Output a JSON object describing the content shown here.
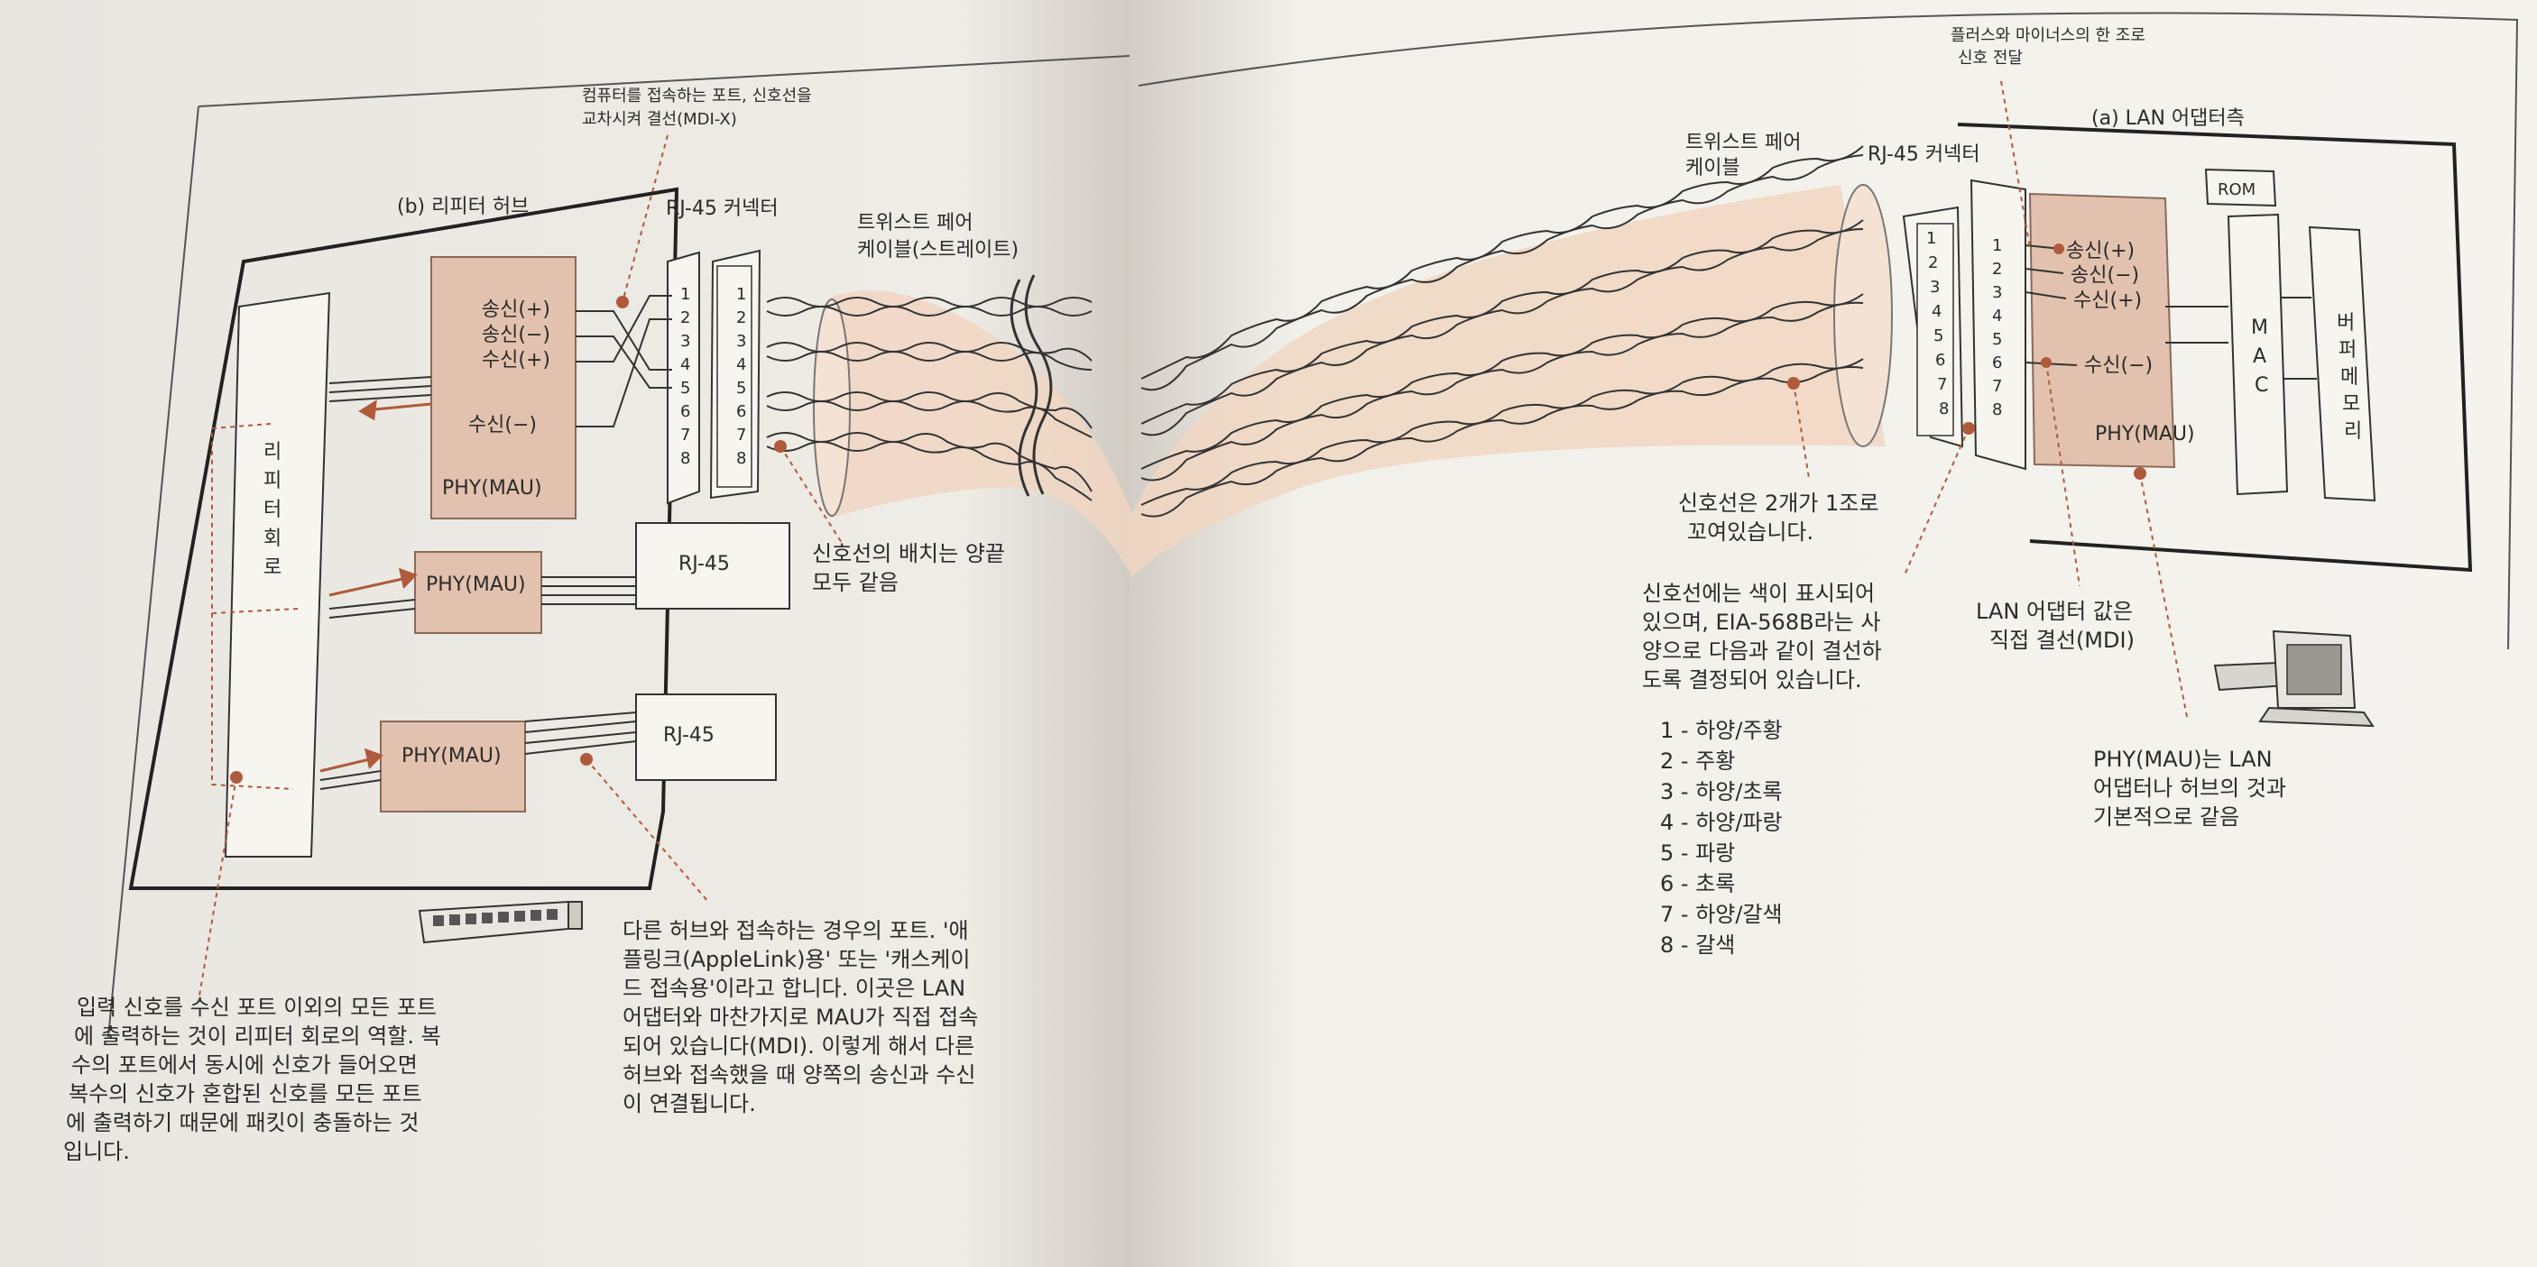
{
  "repeater_hub": {
    "title": "(b) 리피터 허브",
    "repeater_circuit_label": [
      "리",
      "피",
      "터",
      "회",
      "로"
    ],
    "phy_signals": [
      "송신(+)",
      "송신(−)",
      "수신(+)",
      "수신(−)"
    ],
    "phy_main_label": "PHY(MAU)",
    "phy_port2_label": "PHY(MAU)",
    "phy_port3_label": "PHY(MAU)",
    "rj45_connector_label": "RJ-45 커넥터",
    "rj45_port2_label": "RJ-45",
    "rj45_port3_label": "RJ-45",
    "pins_left": [
      "1",
      "2",
      "3",
      "4",
      "5",
      "6",
      "7",
      "8"
    ],
    "pins_right": [
      "1",
      "2",
      "3",
      "4",
      "5",
      "6",
      "7",
      "8"
    ]
  },
  "cable": {
    "left_label_line1": "트위스트 페어",
    "left_label_line2": "케이블(스트레이트)",
    "right_label_line1": "트위스트 페어",
    "right_label_line2": "케이블",
    "right_connector_label": "RJ-45 커넥터"
  },
  "lan_adapter": {
    "title": "(a) LAN 어댑터측",
    "rom_label": "ROM",
    "mac_label": [
      "M",
      "A",
      "C"
    ],
    "buffer_label": [
      "버",
      "퍼",
      "메",
      "모",
      "리"
    ],
    "phy_signals": [
      "송신(+)",
      "송신(−)",
      "수신(+)",
      "수신(−)"
    ],
    "phy_label": "PHY(MAU)",
    "pins_left": [
      "1",
      "2",
      "3",
      "4",
      "5",
      "6",
      "7",
      "8"
    ],
    "pins_right": [
      "1",
      "2",
      "3",
      "4",
      "5",
      "6",
      "7",
      "8"
    ]
  },
  "annotations": {
    "mdix_line1": "컴퓨터를 접속하는 포트, 신호선을",
    "mdix_line2": "교차시켜 결선(MDI-X)",
    "same_line1": "신호선의 배치는 양끝",
    "same_line2": "모두 같음",
    "pair_line1": "플러스와 마이너스의 한 조로",
    "pair_line2": "신호 전달",
    "twisted_line1": "신호선은 2개가 1조로",
    "twisted_line2": "꼬여있습니다.",
    "colors_lines": [
      "신호선에는 색이 표시되어",
      "있으며, EIA-568B라는 사",
      "양으로 다음과 같이 결선하",
      "도록 결정되어 있습니다."
    ],
    "mdi_line1": "LAN 어댑터 값은",
    "mdi_line2": "직접 결선(MDI)",
    "phy_same_lines": [
      "PHY(MAU)는 LAN",
      "어댑터나 허브의 것과",
      "기본적으로 같음"
    ],
    "repeater_role_lines": [
      "입력 신호를 수신 포트 이외의 모든 포트",
      "에 출력하는 것이 리피터 회로의 역할. 복",
      "수의 포트에서 동시에 신호가 들어오면",
      "복수의 신호가 혼합된 신호를 모든 포트",
      "에 출력하기 때문에 패킷이 충돌하는 것",
      "입니다."
    ],
    "cascade_lines": [
      "다른 허브와 접속하는 경우의 포트. '애",
      "플링크(AppleLink)용' 또는 '캐스케이",
      "드 접속용'이라고 합니다. 이곳은 LAN",
      "어댑터와 마찬가지로 MAU가 직접 접속",
      "되어 있습니다(MDI). 이렇게 해서 다른",
      "허브와 접속했을 때 양쪽의 송신과 수신",
      "이 연결됩니다."
    ]
  },
  "wire_colors": [
    "1 - 하양/주황",
    "2 - 주황",
    "3 - 하양/초록",
    "4 - 하양/파랑",
    "5 - 파랑",
    "6 - 초록",
    "7 - 하양/갈색",
    "8 - 갈색"
  ],
  "colors": {
    "accent": "#b05a3c",
    "phy_fill": "#e2c2ae",
    "cable_fill": "#f0d6c2",
    "paper": "#f4f2ec",
    "line": "#2b2b2b"
  }
}
